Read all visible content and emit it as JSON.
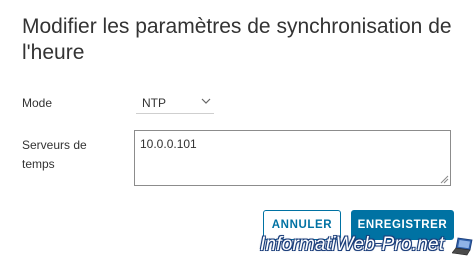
{
  "dialog": {
    "title": "Modifier les paramètres de synchronisation de l'heure"
  },
  "form": {
    "mode_label": "Mode",
    "mode_value": "NTP",
    "servers_label": "Serveurs de temps",
    "servers_value": "10.0.0.101"
  },
  "buttons": {
    "cancel_label": "ANNULER",
    "save_label": "ENREGISTRER"
  },
  "watermark": {
    "text": "InformatiWeb-Pro.net"
  },
  "colors": {
    "accent": "#0072a3",
    "text": "#333333"
  },
  "icons": {
    "select_arrow": "chevron-down-icon",
    "resize_handle": "resize-handle-icon",
    "logo": "laptop-icon"
  }
}
